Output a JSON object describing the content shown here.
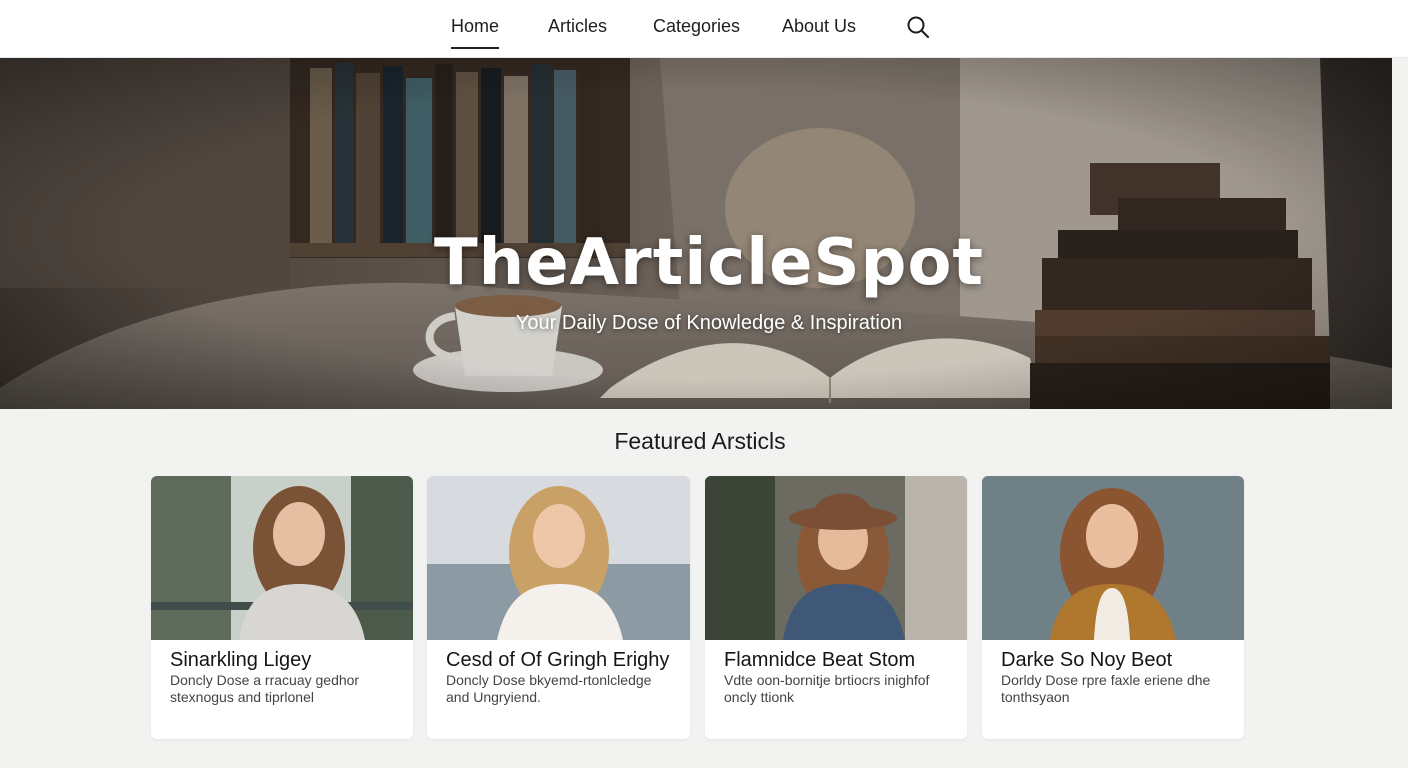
{
  "nav": {
    "items": [
      {
        "label": "Home",
        "active": true
      },
      {
        "label": "Articles",
        "active": false
      },
      {
        "label": "Categories",
        "active": false
      },
      {
        "label": "About Us",
        "active": false
      }
    ],
    "search_icon": "search-icon"
  },
  "hero": {
    "title": "TheArticleSpot",
    "subtitle": "Your Daily Dose of Knowledge & Inspiration"
  },
  "featured": {
    "heading": "Featured Arsticls",
    "cards": [
      {
        "title": "Sinarkling Ligey",
        "excerpt": "Doncly Dose a rracuay gedhor stexnogus and tiprlonel"
      },
      {
        "title": "Cesd of Of Gringh Erighy",
        "excerpt": "Doncly Dose bkyemd-rtonlcledge and Ungryiend."
      },
      {
        "title": "Flamnidce Beat Stom",
        "excerpt": "Vdte oon-bornitje brtiocrs inighfof oncly ttionk"
      },
      {
        "title": "Darke So Noy Beot",
        "excerpt": "Dorldy Dose rpre faxle eriene dhe tonthsyaon"
      }
    ]
  },
  "colors": {
    "page_bg": "#f2f2f1",
    "nav_bg": "#ffffff",
    "text": "#1b1b1b"
  }
}
